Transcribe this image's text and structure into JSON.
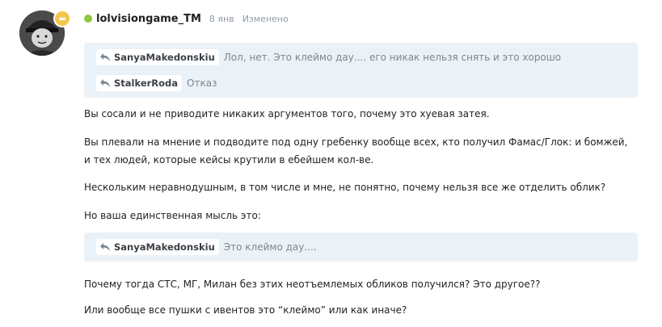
{
  "post": {
    "author": "lolvisiongame_TM",
    "date": "8 янв",
    "edited": "Изменено",
    "online_color": "#8cc63f",
    "badge_icon": "crown-icon",
    "avatar_icon": "avatar-icon"
  },
  "quotes_top": [
    {
      "user": "SanyaMakedonskiu",
      "text": "Лол, нет. Это клеймо дау.... его никак нельзя снять и это хорошо"
    },
    {
      "user": "StalkerRoda",
      "text": "Отказ"
    }
  ],
  "paragraphs": [
    "Вы сосали и не приводите никаких аргументов того, почему это хуевая затея.",
    "Вы плевали на мнение и подводите под одну гребенку вообще всех, кто получил Фамас/Глок: и бомжей, и тех людей, которые кейсы крутили в ебейшем кол-ве.",
    "Нескольким неравнодушным, в том числе и мне, не понятно, почему нельзя все же отделить облик?",
    "Но ваша единственная мысль это:"
  ],
  "quote_mid": {
    "user": "SanyaMakedonskiu",
    "text": "Это клеймо дау...."
  },
  "paragraphs_after": [
    "Почему тогда СТС, МГ, Милан без этих неотъемлемых обликов получился? Это другое??",
    "Или вообще все пушки с ивентов это “клеймо” или как иначе?"
  ],
  "colors": {
    "quote_bg": "#eaf2f7",
    "quote_text": "#7a8792",
    "meta_text": "#909aa3"
  }
}
